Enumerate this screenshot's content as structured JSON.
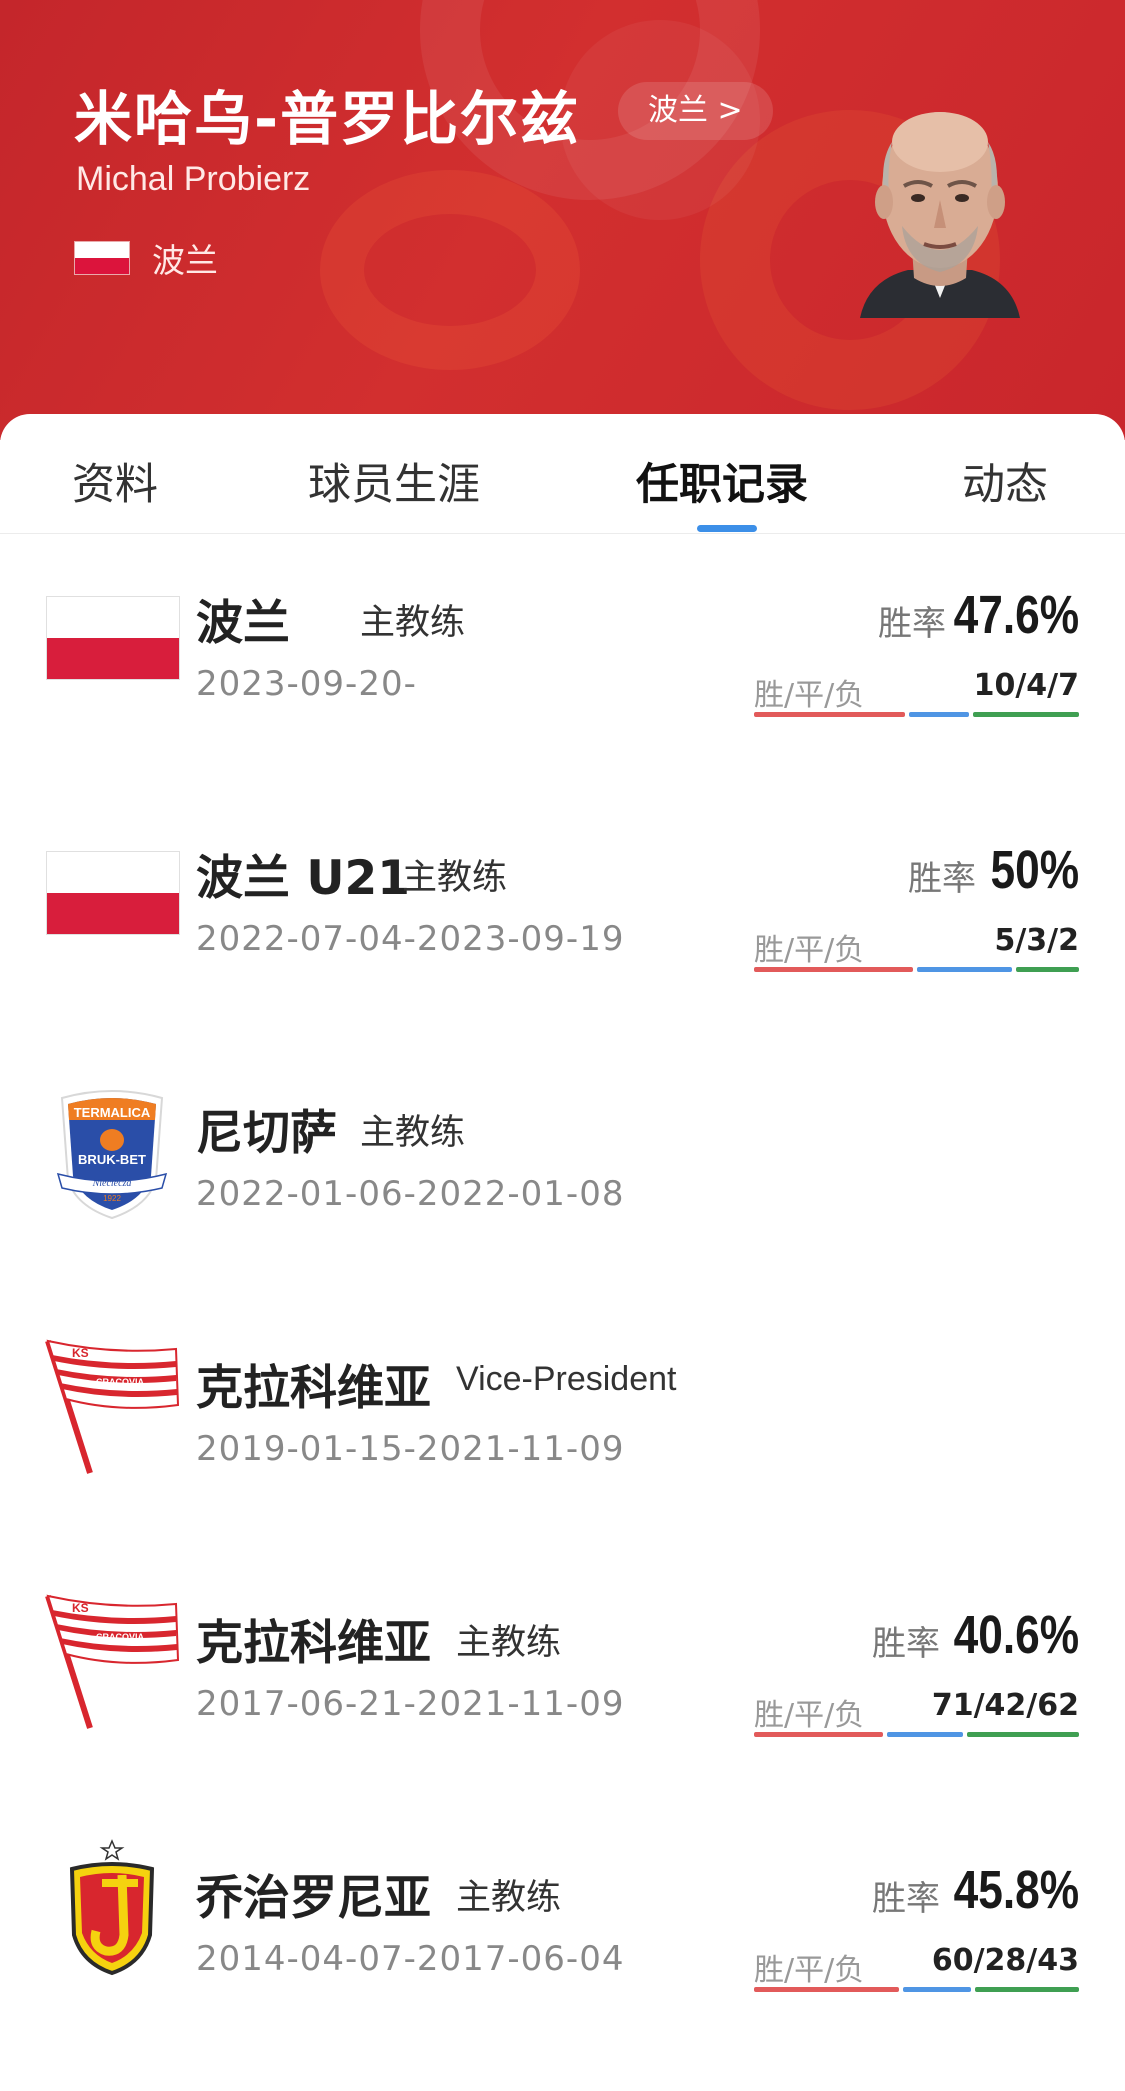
{
  "header": {
    "name_cn": "米哈乌-普罗比尔兹",
    "country_link": "波兰 >",
    "name_en": "Michal Probierz",
    "nationality": "波兰"
  },
  "tabs": [
    "资料",
    "球员生涯",
    "任职记录",
    "动态"
  ],
  "active_tab": "任职记录",
  "labels": {
    "win_rate": "胜率",
    "wdl": "胜/平/负"
  },
  "records": [
    {
      "club": "波兰",
      "role": "主教练",
      "dates": "2023-09-20-",
      "win_rate": "47.6%",
      "wdl": "10/4/7",
      "w": 10,
      "d": 4,
      "l": 7,
      "logo": "poland-flag"
    },
    {
      "club": "波兰 U21",
      "role": "主教练",
      "dates": "2022-07-04-2023-09-19",
      "win_rate": "50%",
      "wdl": "5/3/2",
      "w": 5,
      "d": 3,
      "l": 2,
      "logo": "poland-flag"
    },
    {
      "club": "尼切萨",
      "role": "主教练",
      "dates": "2022-01-06-2022-01-08",
      "logo": "termalica-crest"
    },
    {
      "club": "克拉科维亚",
      "role": "Vice-President",
      "dates": "2019-01-15-2021-11-09",
      "logo": "cracovia-flag"
    },
    {
      "club": "克拉科维亚",
      "role": "主教练",
      "dates": "2017-06-21-2021-11-09",
      "win_rate": "40.6%",
      "wdl": "71/42/62",
      "w": 71,
      "d": 42,
      "l": 62,
      "logo": "cracovia-flag"
    },
    {
      "club": "乔治罗尼亚",
      "role": "主教练",
      "dates": "2014-04-07-2017-06-04",
      "win_rate": "45.8%",
      "wdl": "60/28/43",
      "w": 60,
      "d": 28,
      "l": 43,
      "logo": "jagiellonia-crest"
    }
  ],
  "logo_text": {
    "termalica_top": "TERMALICA",
    "termalica_mid": "BRUK-BET",
    "termalica_ks": "K S",
    "termalica_town": "Nieciecza",
    "termalica_year": "1922",
    "cracovia_ks": "KS",
    "cracovia_name": "CRACOVIA"
  },
  "colors": {
    "header_red": "#c4262b",
    "tab_indicator": "#3c8fe8",
    "win": "#e25a5a",
    "draw": "#4f95e4",
    "loss": "#3f9f52"
  }
}
